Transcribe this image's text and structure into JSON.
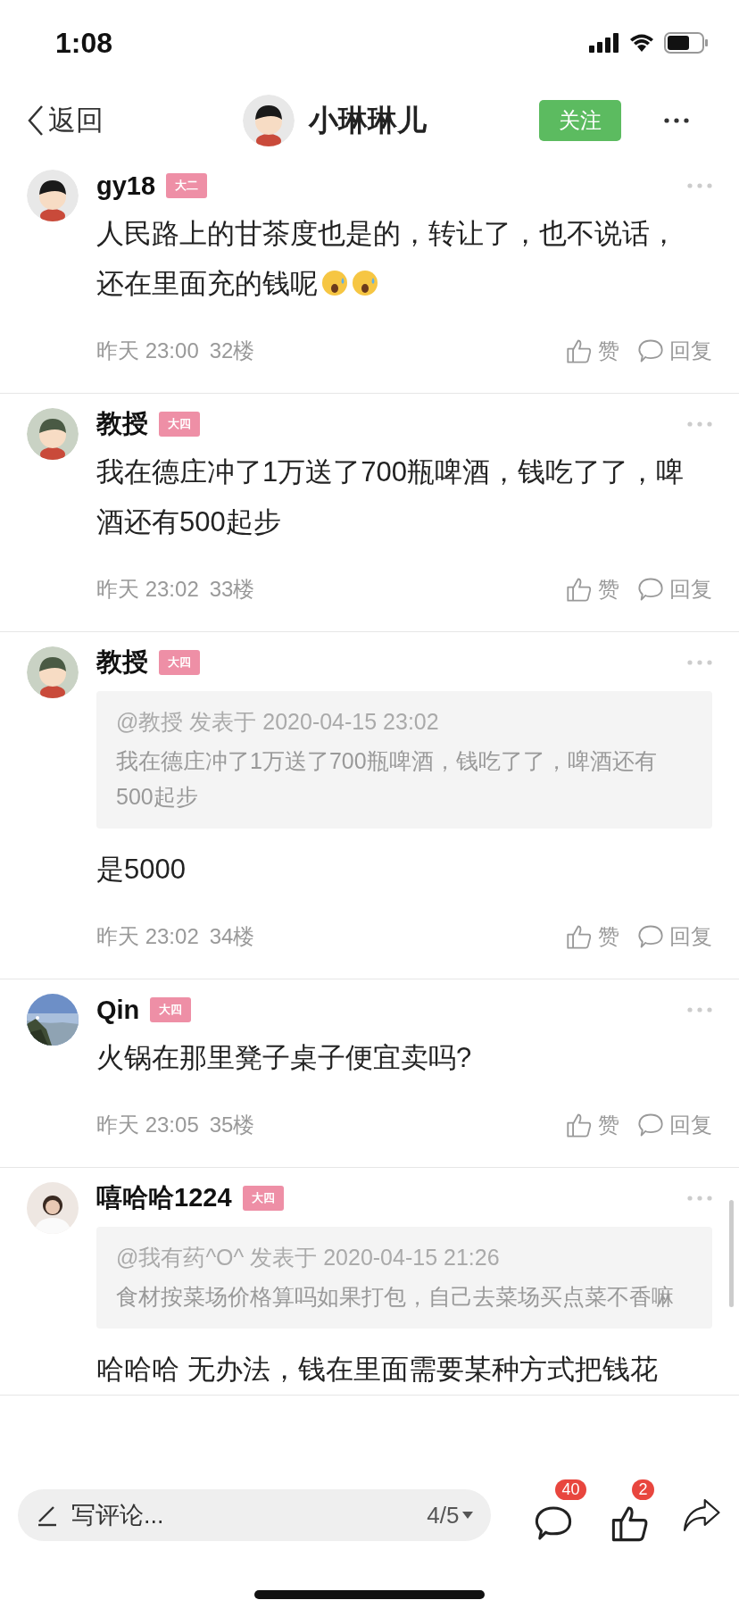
{
  "status_bar": {
    "time": "1:08"
  },
  "header": {
    "back": "返回",
    "title": "小琳琳儿",
    "follow": "关注"
  },
  "comments": [
    {
      "avatar": {
        "kind": "cartoon"
      },
      "name": "gy18",
      "badge": "大二",
      "lines": [
        "人民路上的甘茶度也是的，转让了，也不说话，",
        "还在里面充的钱呢"
      ],
      "emojis": [
        {
          "kind": "surprised"
        },
        {
          "kind": "surprised"
        }
      ],
      "time": "昨天 23:00",
      "floor": "32楼",
      "like": "赞",
      "reply": "回复"
    },
    {
      "avatar": {
        "kind": "cartoon_dark"
      },
      "name": "教授",
      "badge": "大四",
      "text": "我在德庄冲了1万送了700瓶啤酒，钱吃了了，啤酒还有500起步",
      "time": "昨天 23:02",
      "floor": "33楼",
      "like": "赞",
      "reply": "回复"
    },
    {
      "avatar": {
        "kind": "cartoon_dark"
      },
      "name": "教授",
      "badge": "大四",
      "quote": {
        "meta": "@教授 发表于 2020-04-15 23:02",
        "text": "我在德庄冲了1万送了700瓶啤酒，钱吃了了，啤酒还有500起步"
      },
      "text": "是5000",
      "time": "昨天 23:02",
      "floor": "34楼",
      "like": "赞",
      "reply": "回复"
    },
    {
      "name": "Qin",
      "badge": "大四",
      "text": "火锅在那里凳子桌子便宜卖吗?",
      "time": "昨天 23:05",
      "floor": "35楼",
      "like": "赞",
      "reply": "回复"
    },
    {
      "avatar": {
        "kind": "person"
      },
      "name": "嘻哈哈1224",
      "badge": "大四",
      "quote": {
        "meta": "@我有药^O^ 发表于 2020-04-15 21:26",
        "text": "食材按菜场价格算吗如果打包，自己去菜场买点菜不香嘛"
      },
      "text": "哈哈哈 无办法，钱在里面需要某种方式把钱花"
    }
  ],
  "bottom_bar": {
    "placeholder": "写评论...",
    "page": "4/5",
    "comment_count": "40",
    "like_count": "2"
  }
}
